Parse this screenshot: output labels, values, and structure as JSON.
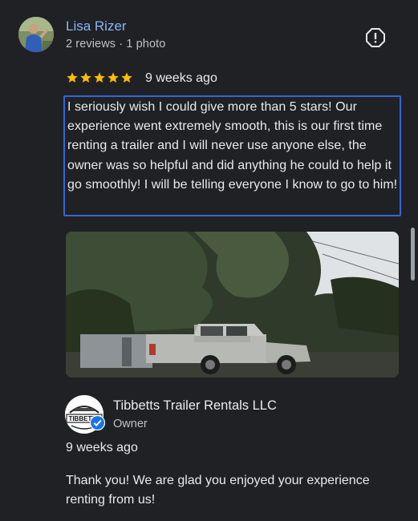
{
  "review": {
    "reviewer_name": "Lisa Rizer",
    "reviewer_meta": "2 reviews · 1 photo",
    "rating": 5,
    "rating_max": 5,
    "date": "9 weeks ago",
    "text": "I seriously wish I could give more than 5 stars! Our experience went extremely smooth, this is our first time renting a trailer and I will never use anyone else, the owner was so helpful and did anything he could to help it go smoothly! I will be telling everyone I know to go to him!",
    "star_color": "#fbbc04",
    "name_color": "#8ab4f8",
    "focus_outline_color": "#3367d6"
  },
  "icons": {
    "report": "report-flag-icon",
    "verified": "verified-check-icon"
  },
  "owner_response": {
    "business_name": "Tibbetts Trailer Rentals LLC",
    "logo_text": "TIBBETTS",
    "role": "Owner",
    "date": "9 weeks ago",
    "text": "Thank you! We are glad you enjoyed your experience renting from us!"
  }
}
